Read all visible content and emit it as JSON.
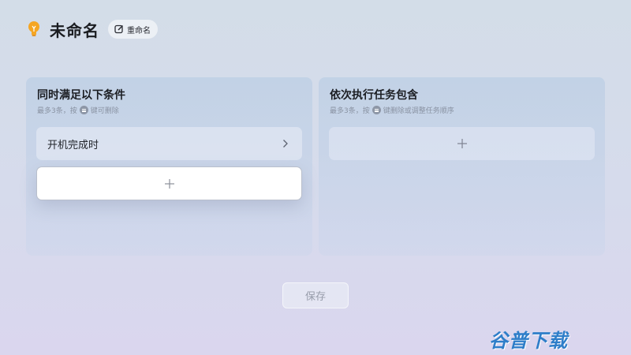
{
  "header": {
    "title": "未命名",
    "rename_label": "重命名",
    "bulb_icon": "lightbulb-icon",
    "edit_icon": "edit-icon"
  },
  "conditions_panel": {
    "title": "同时满足以下条件",
    "hint_before": "最多3条，按",
    "hint_after": "键可删除",
    "items": [
      {
        "label": "开机完成时",
        "icon": "chevron-right-icon"
      }
    ],
    "add_icon": "plus-icon"
  },
  "tasks_panel": {
    "title": "依次执行任务包含",
    "hint_before": "最多3条，按",
    "hint_after": "键删除或调整任务顺序",
    "add_icon": "plus-icon"
  },
  "footer": {
    "save_label": "保存"
  },
  "watermark": {
    "text": "谷普下载"
  },
  "colors": {
    "accent_bulb": "#f5a623",
    "watermark": "#2e7ec9"
  }
}
